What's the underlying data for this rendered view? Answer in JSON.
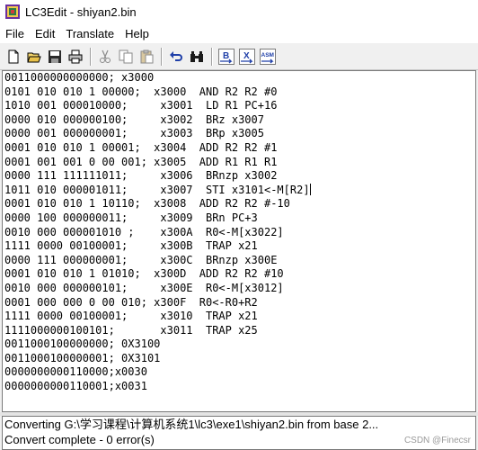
{
  "window": {
    "title": "LC3Edit - shiyan2.bin"
  },
  "menu": [
    "File",
    "Edit",
    "Translate",
    "Help"
  ],
  "toolbar": {
    "buttons": [
      "new-file",
      "open-file",
      "save-file",
      "print",
      "cut",
      "copy",
      "paste",
      "undo",
      "find",
      "to-binary",
      "to-hex",
      "to-asm"
    ],
    "labels": {
      "binary": "B",
      "hex": "X",
      "asm": "ASM"
    }
  },
  "editor": {
    "lines": [
      "0011000000000000; x3000",
      "0101 010 010 1 00000;  x3000  AND R2 R2 #0",
      "1010 001 000010000;     x3001  LD R1 PC+16",
      "0000 010 000000100;     x3002  BRz x3007",
      "0000 001 000000001;     x3003  BRp x3005",
      "0001 010 010 1 00001;  x3004  ADD R2 R2 #1",
      "0001 001 001 0 00 001; x3005  ADD R1 R1 R1",
      "0000 111 111111011;     x3006  BRnzp x3002",
      "1011 010 000001011;     x3007  STI x3101<-M[R2]",
      "0001 010 010 1 10110;  x3008  ADD R2 R2 #-10",
      "0000 100 000000011;     x3009  BRn PC+3",
      "0010 000 000001010 ;    x300A  R0<-M[x3022]",
      "1111 0000 00100001;     x300B  TRAP x21",
      "0000 111 000000001;     x300C  BRnzp x300E",
      "0001 010 010 1 01010;  x300D  ADD R2 R2 #10",
      "0010 000 000000101;     x300E  R0<-M[x3012]",
      "0001 000 000 0 00 010; x300F  R0<-R0+R2",
      "1111 0000 00100001;     x3010  TRAP x21",
      "1111000000100101;       x3011  TRAP x25",
      "0011000100000000; 0X3100",
      "0011000100000001; 0X3101",
      "0000000000110000;x0030",
      "0000000000110001;x0031"
    ]
  },
  "output": {
    "lines": [
      "Converting G:\\学习课程\\计算机系统1\\lc3\\exe1\\shiyan2.bin from base 2...",
      "Convert complete - 0 error(s)"
    ]
  },
  "watermark": "CSDN @Finecsr"
}
